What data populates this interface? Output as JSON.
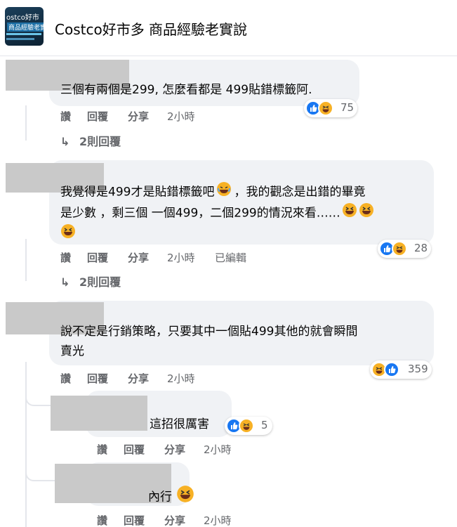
{
  "group": {
    "avatar_line1": "ostco好市",
    "avatar_line2": "商品經驗老實",
    "title": "Costco好市多 商品經驗老實說"
  },
  "actions": {
    "like": "讚",
    "reply": "回覆",
    "share": "分享",
    "edited": "已編輯"
  },
  "comments": [
    {
      "text_lines": [
        "三個有兩個是299, 怎麼看都是 499貼錯標籤阿."
      ],
      "time": "2小時",
      "reactions": [
        "like",
        "haha"
      ],
      "count": "75",
      "replies_label": "2則回覆"
    },
    {
      "text_line1": "我覺得是499才是貼錯標籤吧",
      "text_line1b": "，我的觀念是出錯的畢竟",
      "text_line2": "是少數 ，剩三個 一個499，二個299的情況來看……",
      "time": "2小時",
      "reactions": [
        "like",
        "haha"
      ],
      "count": "28",
      "replies_label": "2則回覆"
    },
    {
      "text_lines": [
        "說不定是行銷策略，只要其中一個貼499其他的就會瞬間",
        "賣光"
      ],
      "time": "2小時",
      "reactions": [
        "haha",
        "like"
      ],
      "count": "359"
    }
  ],
  "replies": [
    {
      "text": "這招很厲害",
      "time": "2小時",
      "reactions": [
        "like",
        "haha"
      ],
      "count": "5"
    },
    {
      "text": "內行",
      "time": "2小時"
    }
  ],
  "colors": {
    "like": "#1877f2",
    "haha": "#f7b125",
    "bubble": "#f0f2f5",
    "meta": "#65676b"
  }
}
